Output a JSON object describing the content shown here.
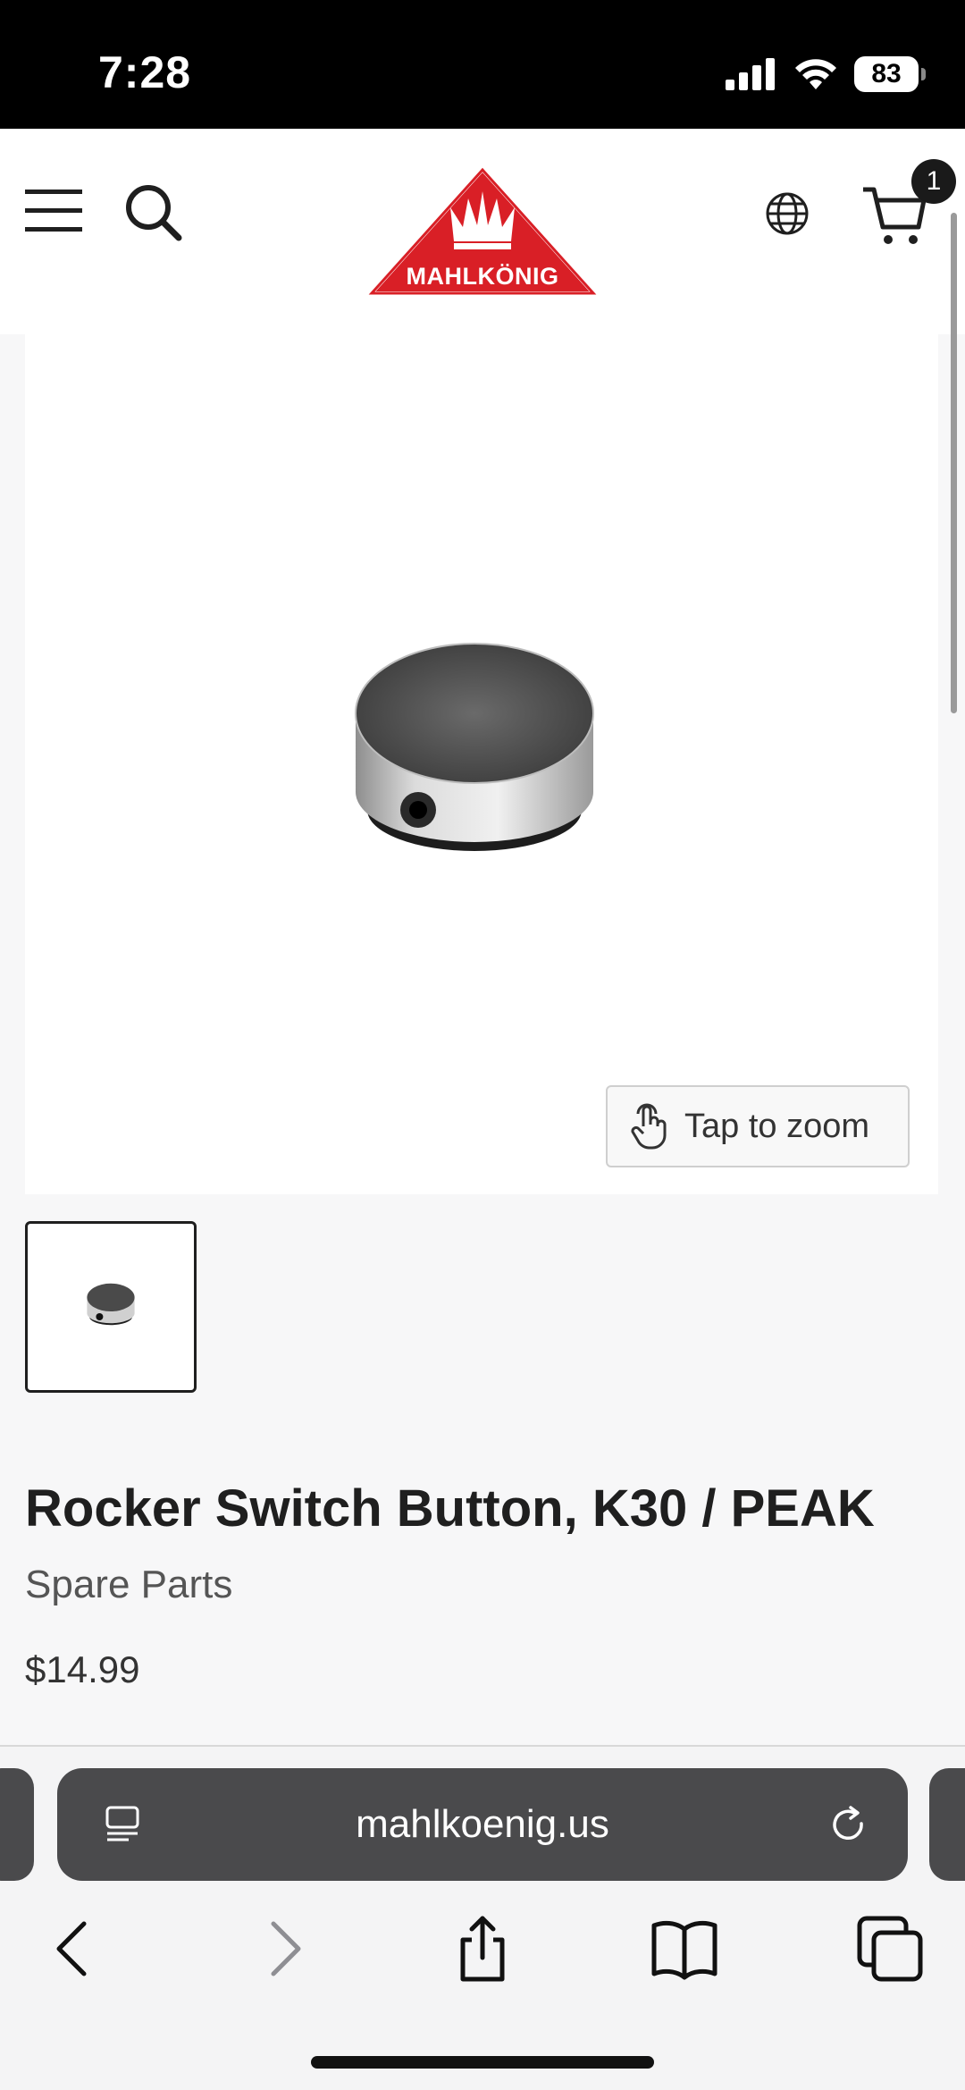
{
  "status_bar": {
    "time": "7:28",
    "battery": "83"
  },
  "header": {
    "logo_text": "MAHLKÖNIG",
    "cart_count": "1"
  },
  "product": {
    "zoom_label": "Tap to zoom",
    "title": "Rocker Switch Button, K30 / PEAK",
    "category": "Spare Parts",
    "price": "$14.99"
  },
  "browser": {
    "url": "mahlkoenig.us"
  },
  "colors": {
    "brand_red": "#d91f26",
    "url_bar": "#4a4a4c"
  },
  "icons": [
    "menu-icon",
    "search-icon",
    "globe-icon",
    "cart-icon",
    "hand-pointer-icon",
    "page-icon",
    "reload-icon",
    "back-icon",
    "forward-icon",
    "share-icon",
    "bookmarks-icon",
    "tabs-icon"
  ]
}
